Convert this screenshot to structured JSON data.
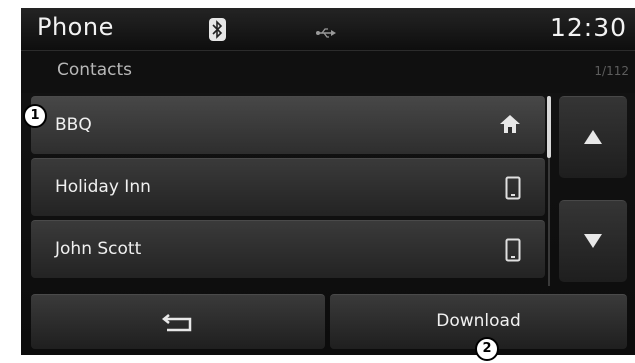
{
  "header": {
    "title": "Phone",
    "clock": "12:30",
    "icons": [
      "bluetooth-icon",
      "usb-icon"
    ]
  },
  "subheader": {
    "title": "Contacts",
    "page_count": "1/112"
  },
  "contacts": [
    {
      "name": "BBQ",
      "type_icon": "home-icon",
      "selected": true
    },
    {
      "name": "Holiday Inn",
      "type_icon": "mobile-icon",
      "selected": false
    },
    {
      "name": "John Scott",
      "type_icon": "mobile-icon",
      "selected": false
    }
  ],
  "side_buttons": {
    "up_icon": "arrow-up-icon",
    "down_icon": "arrow-down-icon"
  },
  "bottom_buttons": {
    "back_icon": "back-icon",
    "download_label": "Download"
  },
  "callouts": {
    "one": "1",
    "two": "2"
  },
  "colors": {
    "background": "#141414",
    "button": "#2e2e2e",
    "text": "#f0f0f0",
    "dim_text": "#b7b7b7"
  }
}
